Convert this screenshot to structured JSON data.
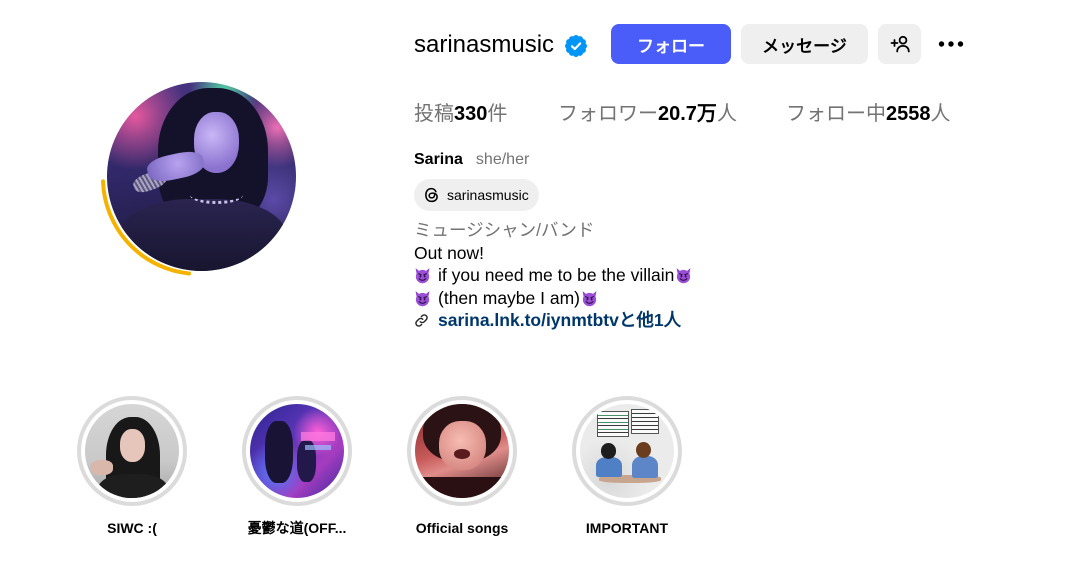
{
  "profile": {
    "username": "sarinasmusic",
    "verified": true,
    "actions": {
      "follow_label": "フォロー",
      "message_label": "メッセージ"
    },
    "stats": [
      {
        "label": "投稿",
        "value": "330",
        "suffix": "件"
      },
      {
        "label": "フォロワー",
        "value": "20.7万",
        "suffix": "人"
      },
      {
        "label": "フォロー中",
        "value": "2558",
        "suffix": "人"
      }
    ],
    "display_name": "Sarina",
    "pronouns": "she/her",
    "threads_badge": {
      "handle": "sarinasmusic",
      "icon": "threads-icon"
    },
    "bio": {
      "category": "ミュージシャン/バンド",
      "lines": [
        "Out now!",
        "if you need me to be the villain",
        "(then maybe I am)"
      ],
      "emoji_icon": "smiling-face-with-horns-icon",
      "link": {
        "text": "sarina.lnk.to/iynmtbtvと他1人",
        "icon": "link-icon"
      }
    }
  },
  "highlights": [
    {
      "label": "SIWC :("
    },
    {
      "label": "憂鬱な道(OFF..."
    },
    {
      "label": "Official songs"
    },
    {
      "label": "IMPORTANT"
    }
  ],
  "icons": {
    "verified": "verified-badge-icon",
    "add_person": "add-person-icon",
    "more": "more-options-icon"
  },
  "colors": {
    "primary_button": "#4a5df9",
    "secondary_button": "#efefef",
    "link": "#00376b",
    "verified": "#0095f6",
    "muted_text": "#737373",
    "story_ring": "#f5b301",
    "highlight_ring": "#dbdbdb"
  }
}
